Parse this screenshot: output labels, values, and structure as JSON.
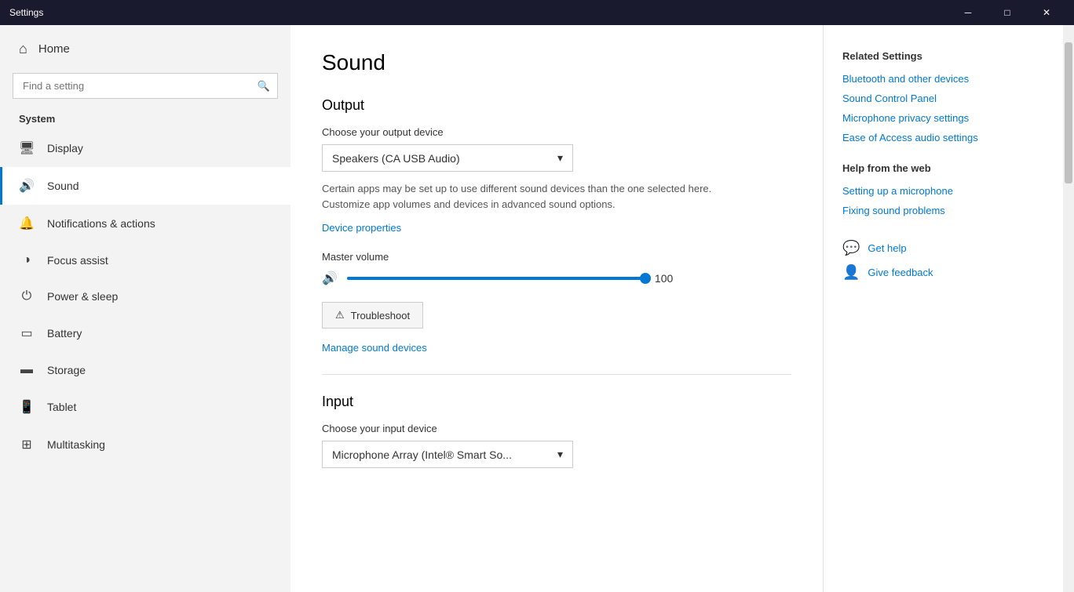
{
  "titlebar": {
    "title": "Settings",
    "minimize_label": "─",
    "maximize_label": "□",
    "close_label": "✕"
  },
  "sidebar": {
    "home_label": "Home",
    "search_placeholder": "Find a setting",
    "section_title": "System",
    "items": [
      {
        "id": "display",
        "label": "Display",
        "icon": "⬜"
      },
      {
        "id": "sound",
        "label": "Sound",
        "icon": "🔊"
      },
      {
        "id": "notifications",
        "label": "Notifications & actions",
        "icon": "🔔"
      },
      {
        "id": "focus-assist",
        "label": "Focus assist",
        "icon": "◑"
      },
      {
        "id": "power",
        "label": "Power & sleep",
        "icon": "⏻"
      },
      {
        "id": "battery",
        "label": "Battery",
        "icon": "🔋"
      },
      {
        "id": "storage",
        "label": "Storage",
        "icon": "📦"
      },
      {
        "id": "tablet",
        "label": "Tablet",
        "icon": "💻"
      },
      {
        "id": "multitasking",
        "label": "Multitasking",
        "icon": "⊞"
      }
    ]
  },
  "main": {
    "page_title": "Sound",
    "output_section": "Output",
    "output_device_label": "Choose your output device",
    "output_device_value": "Speakers (CA USB Audio)",
    "output_info": "Certain apps may be set up to use different sound devices than the one selected here. Customize app volumes and devices in advanced sound options.",
    "device_properties_link": "Device properties",
    "volume_label": "Master volume",
    "volume_value": "100",
    "troubleshoot_label": "Troubleshoot",
    "manage_devices_link": "Manage sound devices",
    "input_section": "Input",
    "input_device_label": "Choose your input device",
    "input_device_value": "Microphone Array (Intel® Smart So..."
  },
  "right_panel": {
    "related_title": "Related Settings",
    "links": [
      {
        "id": "bluetooth",
        "label": "Bluetooth and other devices"
      },
      {
        "id": "sound-control",
        "label": "Sound Control Panel"
      },
      {
        "id": "microphone-privacy",
        "label": "Microphone privacy settings"
      },
      {
        "id": "ease-access",
        "label": "Ease of Access audio settings"
      }
    ],
    "help_title": "Help from the web",
    "help_links": [
      {
        "id": "setup-mic",
        "label": "Setting up a microphone"
      },
      {
        "id": "fix-sound",
        "label": "Fixing sound problems"
      }
    ],
    "get_help_label": "Get help",
    "feedback_label": "Give feedback"
  }
}
